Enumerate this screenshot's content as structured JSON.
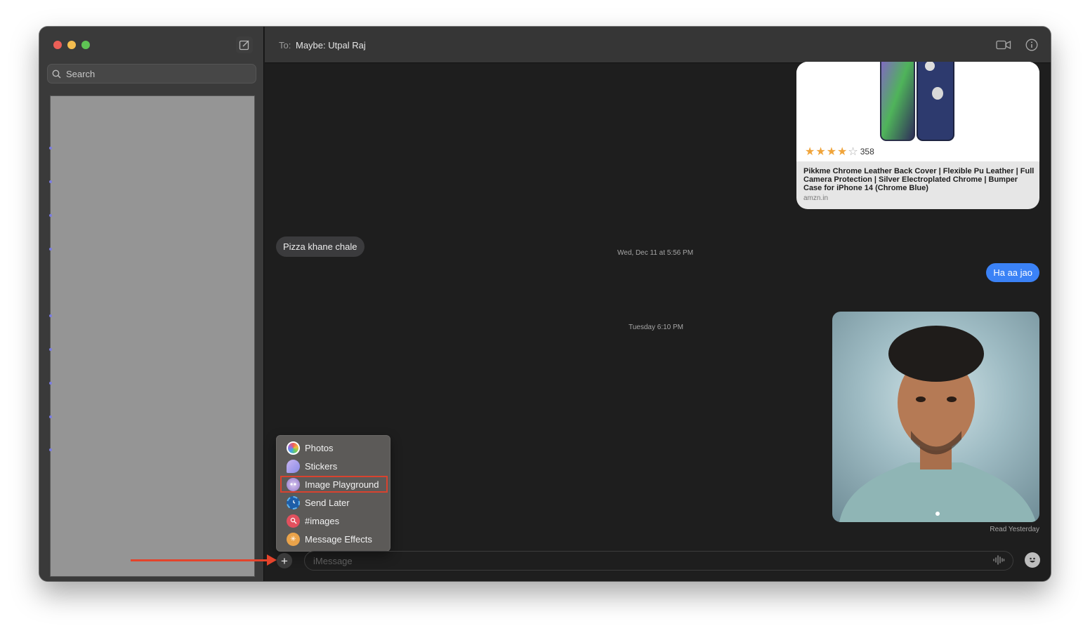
{
  "window": {
    "traffic_lights": [
      "close",
      "minimize",
      "zoom"
    ]
  },
  "sidebar": {
    "compose_icon": "compose-icon",
    "search": {
      "placeholder": "Search",
      "value": ""
    }
  },
  "header": {
    "to_label": "To:",
    "recipient": "Maybe: Utpal Raj",
    "video_icon": "video-camera-icon",
    "info_icon": "info-icon"
  },
  "chat": {
    "link_preview": {
      "rating_stars": 4,
      "rating_max": 5,
      "rating_count": "358",
      "title": "Pikkme Chrome Leather Back Cover | Flexible Pu Leather | Full Camera Protection | Silver Electroplated Chrome | Bumper Case for iPhone 14 (Chrome Blue)",
      "domain": "amzn.in"
    },
    "timestamp_1": "Wed, Dec 11 at 5:56 PM",
    "incoming_message": "Pizza khane chale",
    "outgoing_message": "Ha aa jao",
    "timestamp_2": "Tuesday 6:10 PM",
    "read_receipt": "Read Yesterday"
  },
  "apps_menu": {
    "items": [
      {
        "label": "Photos",
        "icon": "photos-icon"
      },
      {
        "label": "Stickers",
        "icon": "stickers-icon"
      },
      {
        "label": "Image Playground",
        "icon": "image-playground-icon",
        "highlighted": true
      },
      {
        "label": "Send Later",
        "icon": "send-later-icon"
      },
      {
        "label": "#images",
        "icon": "images-search-icon"
      },
      {
        "label": "Message Effects",
        "icon": "message-effects-icon"
      }
    ]
  },
  "compose": {
    "plus_label": "+",
    "placeholder": "iMessage",
    "value": ""
  },
  "colors": {
    "accent_blue": "#3b82f6",
    "annotation_red": "#e4432b"
  }
}
